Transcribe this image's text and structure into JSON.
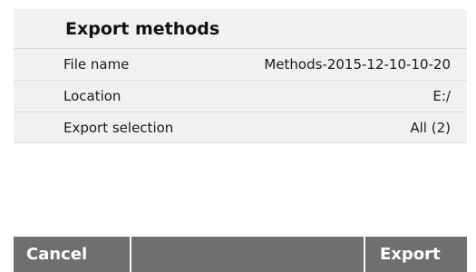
{
  "dialog": {
    "title": "Export methods",
    "rows": [
      {
        "label": "File name",
        "value": "Methods-2015-12-10-10-20"
      },
      {
        "label": "Location",
        "value": "E:/"
      },
      {
        "label": "Export selection",
        "value": "All (2)"
      }
    ]
  },
  "buttons": {
    "cancel": "Cancel",
    "export": "Export"
  },
  "colors": {
    "panel_bg": "#f1f1f1",
    "button_bg": "#6f6f6f",
    "button_text": "#ffffff"
  }
}
